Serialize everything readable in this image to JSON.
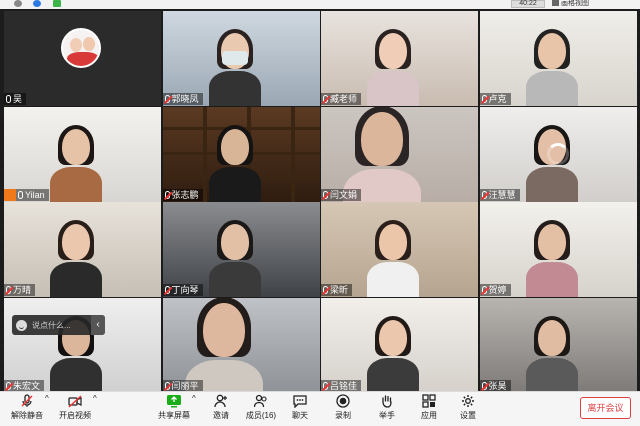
{
  "topbar": {
    "timer": "40:22",
    "view_label": "画格视图"
  },
  "participants": [
    {
      "name": "吴",
      "muted": false
    },
    {
      "name": "郭晓凤",
      "muted": true
    },
    {
      "name": "臧老师",
      "muted": true
    },
    {
      "name": "卢克",
      "muted": true
    },
    {
      "name": "Yilan",
      "muted": false,
      "host_badge": true
    },
    {
      "name": "张志鹏",
      "muted": true
    },
    {
      "name": "闫文娟",
      "muted": true
    },
    {
      "name": "汪慧慧",
      "muted": true,
      "loading": true
    },
    {
      "name": "万晴",
      "muted": true
    },
    {
      "name": "丁向琴",
      "muted": true
    },
    {
      "name": "梁昕",
      "muted": true
    },
    {
      "name": "贺婷",
      "muted": true
    },
    {
      "name": "朱宏文",
      "muted": true
    },
    {
      "name": "闫丽平",
      "muted": true
    },
    {
      "name": "吕铭佳",
      "muted": true
    },
    {
      "name": "张昊",
      "muted": true
    }
  ],
  "chat": {
    "placeholder": "说点什么...",
    "collapse_icon": "chevron-left-icon"
  },
  "toolbar": {
    "unmute": "解除静音",
    "start_video": "开启视频",
    "share_screen": "共享屏幕",
    "invite": "邀请",
    "members": "成员(16)",
    "chat": "聊天",
    "record": "录制",
    "raise_hand": "举手",
    "apps": "应用",
    "settings": "设置",
    "leave": "离开会议"
  },
  "colors": {
    "accent": "#1aad19",
    "leave": "#e04040",
    "toolbar_bg": "#f5f5f5"
  }
}
